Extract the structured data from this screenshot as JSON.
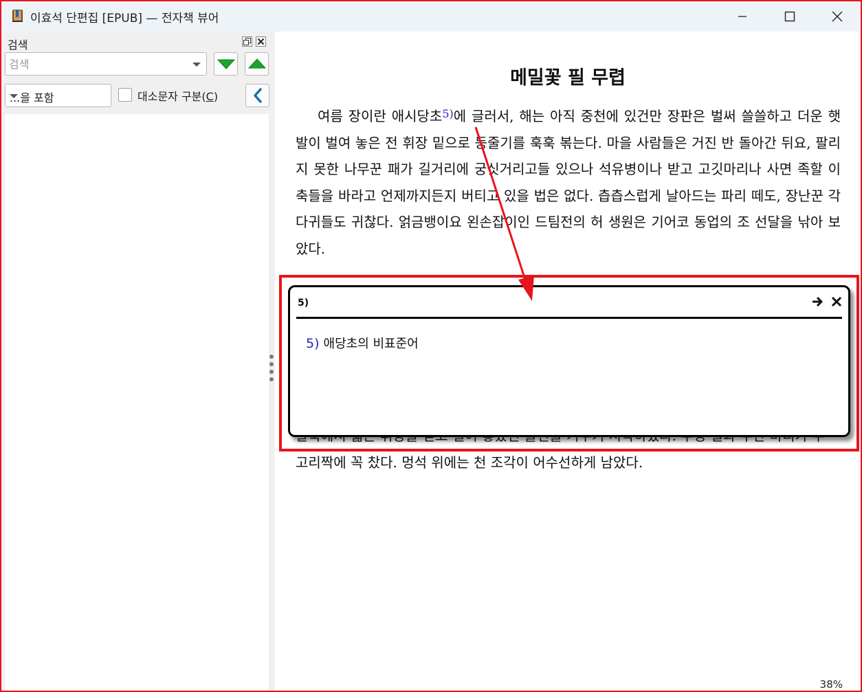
{
  "window": {
    "title": "이효석 단편집 [EPUB] — 전자책 뷰어",
    "icon": "book-app-icon",
    "controls": [
      "minimize-icon",
      "maximize-icon",
      "close-icon"
    ]
  },
  "search_panel": {
    "label": "검색",
    "input_value": "",
    "input_placeholder": "검색",
    "mode_selected": "...을 포함",
    "case_label": "대소문자 구분(",
    "case_mnemonic": "C",
    "case_label_end": ")",
    "case_checked": false,
    "icons": [
      "restore-panel-icon",
      "close-panel-icon",
      "search-next-icon",
      "search-previous-icon",
      "collapse-left-icon"
    ]
  },
  "reader": {
    "chapter_title": "메밀꽃 필 무렵",
    "para1_before": "여름 장이란 애시당초",
    "para1_ref": "5)",
    "para1_after": "에 글러서, 해는 아직 중천에 있건만 장판은 벌써 쓸쓸하고 더운 햇발이 벌여 놓은 전 휘장 밑으로 등줄기를 훅훅 볶는다. 마을 사람들은 거진 반 돌아간 뒤요, 팔리지 못한 나무꾼 패가 길거리에 궁싯거리고들 있으나 석유병이나 받고 고깃마리나 사면 족할 이 축들을 바라고 언제까지든지 버티고 있을 법은 없다. 츱츱스럽게 날아드는 파리 떼도, 장난꾼 각다귀들도 귀찮다. 얽금뱅이요 왼손잡이인 드팀전의 허 생원은 기어코 동업의 조 선달을 낚아 보았다.",
    "para2": "말뚝에서 넓은 휘장을 걷고 벌여 놓았던 물건을 거두기 시작하였다. 무명 필과 주단 바리가 두 고리짝에 꼭 찼다. 멍석 위에는 천 조각이 어수선하게 남았다.",
    "progress_label": "38%"
  },
  "footnote_popup": {
    "title": "5)",
    "note_number": "5)",
    "note_text": "애당초의 비표준어",
    "icons": [
      "go-to-note-icon",
      "close-popup-icon"
    ]
  },
  "colors": {
    "annotation": "#e8141b",
    "footnote_link": "#1f2ab8",
    "nav_arrow_green": "#1ca52c",
    "collapse_arrow_blue": "#1a6fa8",
    "titlebar_bg": "#eef3f8"
  }
}
